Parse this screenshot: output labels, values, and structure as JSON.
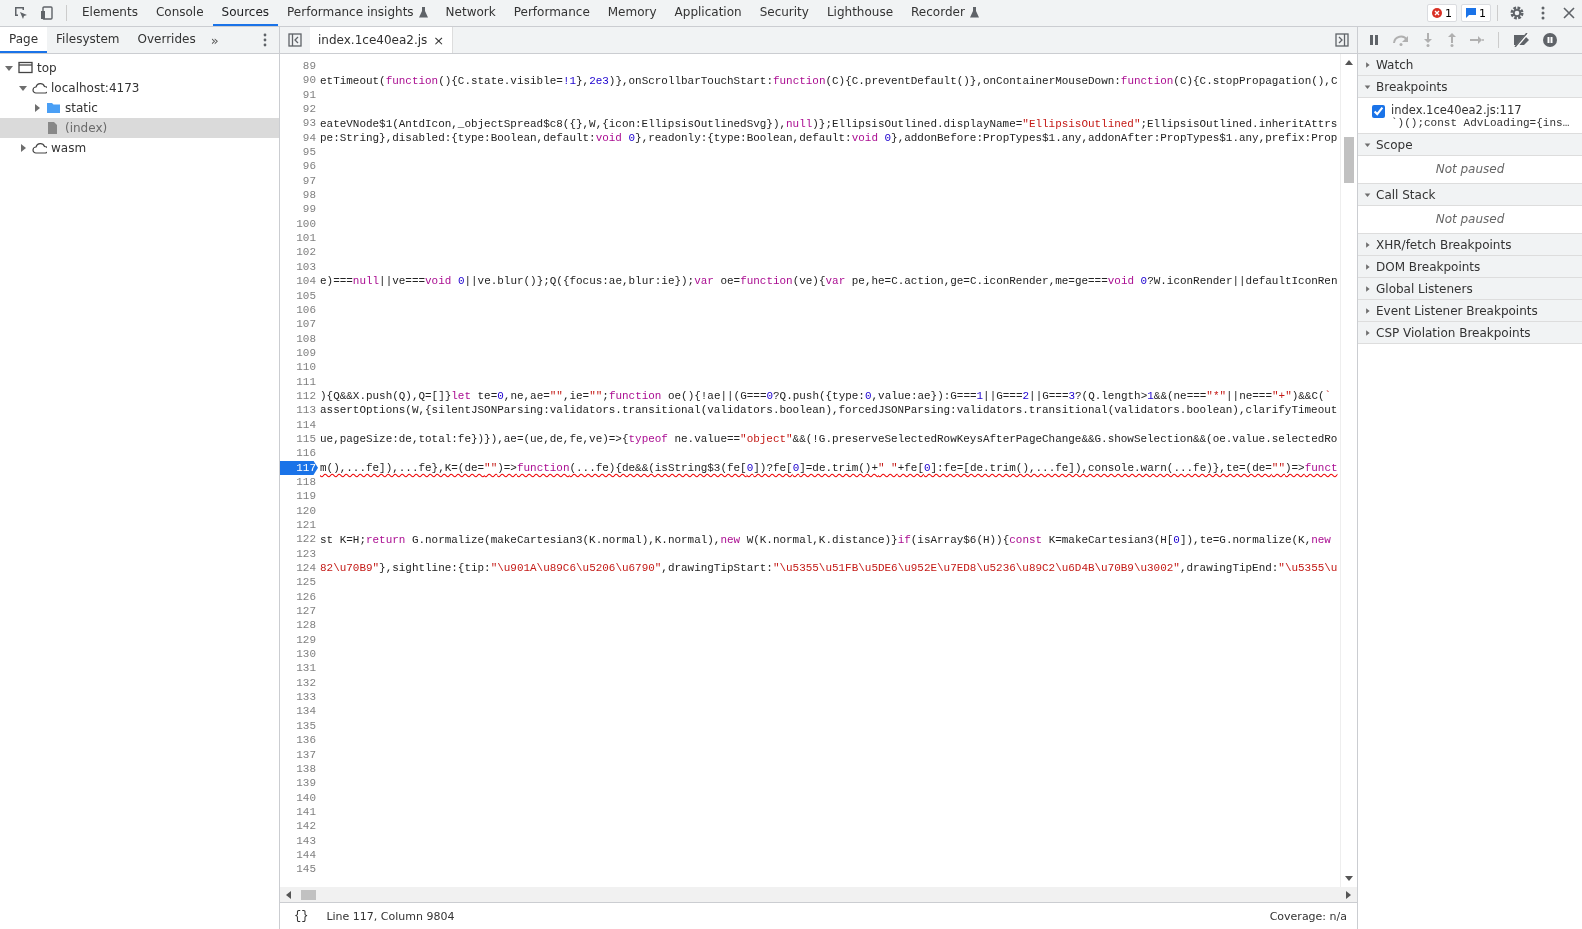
{
  "main_tabs": [
    {
      "label": "Elements",
      "selected": false
    },
    {
      "label": "Console",
      "selected": false
    },
    {
      "label": "Sources",
      "selected": true
    },
    {
      "label": "Performance insights",
      "selected": false,
      "experimental": true
    },
    {
      "label": "Network",
      "selected": false
    },
    {
      "label": "Performance",
      "selected": false
    },
    {
      "label": "Memory",
      "selected": false
    },
    {
      "label": "Application",
      "selected": false
    },
    {
      "label": "Security",
      "selected": false
    },
    {
      "label": "Lighthouse",
      "selected": false
    },
    {
      "label": "Recorder",
      "selected": false,
      "experimental": true
    }
  ],
  "counters": [
    {
      "kind": "error",
      "count": "1"
    },
    {
      "kind": "message",
      "count": "1"
    }
  ],
  "navigator": {
    "tabs": [
      {
        "label": "Page",
        "selected": true
      },
      {
        "label": "Filesystem",
        "selected": false
      },
      {
        "label": "Overrides",
        "selected": false
      }
    ],
    "more": "»",
    "tree": [
      {
        "label": "top",
        "kind": "frame",
        "expanded": true,
        "selected": false,
        "children": [
          {
            "label": "localhost:4173",
            "kind": "cloud",
            "expanded": true,
            "selected": false,
            "children": [
              {
                "label": "static",
                "kind": "folder",
                "expanded": false,
                "selected": false
              },
              {
                "label": "(index)",
                "kind": "file",
                "selected": true
              }
            ]
          },
          {
            "label": "wasm",
            "kind": "cloud",
            "expanded": false,
            "selected": false
          }
        ]
      }
    ]
  },
  "editor": {
    "file_tab": {
      "label": "index.1ce40ea2.js",
      "close": "×"
    },
    "lines": [
      {
        "number": "89"
      },
      {
        "number": "90",
        "tokens": [
          {
            "text": "etTimeout(",
            "kind": "plain"
          },
          {
            "text": "function",
            "kind": "keyword"
          },
          {
            "text": "(){C.state.visible=",
            "kind": "plain"
          },
          {
            "text": "!1",
            "kind": "number"
          },
          {
            "text": "},",
            "kind": "plain"
          },
          {
            "text": "2e3",
            "kind": "number"
          },
          {
            "text": ")},onScrollbarTouchStart:",
            "kind": "plain"
          },
          {
            "text": "function",
            "kind": "keyword"
          },
          {
            "text": "(C){C.preventDefault()},onContainerMouseDown:",
            "kind": "plain"
          },
          {
            "text": "function",
            "kind": "keyword"
          },
          {
            "text": "(C){C.stopPropagation(),C",
            "kind": "plain"
          }
        ]
      },
      {
        "number": "91"
      },
      {
        "number": "92"
      },
      {
        "number": "93",
        "tokens": [
          {
            "text": "eateVNode$1(AntdIcon,_objectSpread$c8({},W,{icon:EllipsisOutlinedSvg}),",
            "kind": "plain"
          },
          {
            "text": "null",
            "kind": "keyword"
          },
          {
            "text": ")};EllipsisOutlined.displayName=",
            "kind": "plain"
          },
          {
            "text": "\"EllipsisOutlined\"",
            "kind": "string"
          },
          {
            "text": ";EllipsisOutlined.inheritAttrs",
            "kind": "plain"
          }
        ]
      },
      {
        "number": "94",
        "tokens": [
          {
            "text": "pe:String},disabled:{type:Boolean,default:",
            "kind": "plain"
          },
          {
            "text": "void ",
            "kind": "keyword"
          },
          {
            "text": "0",
            "kind": "number"
          },
          {
            "text": "},readonly:{type:Boolean,default:",
            "kind": "plain"
          },
          {
            "text": "void ",
            "kind": "keyword"
          },
          {
            "text": "0",
            "kind": "number"
          },
          {
            "text": "},addonBefore:PropTypes$1.any,addonAfter:PropTypes$1.any,prefix:Prop",
            "kind": "plain"
          }
        ]
      },
      {
        "number": "95"
      },
      {
        "number": "96"
      },
      {
        "number": "97"
      },
      {
        "number": "98"
      },
      {
        "number": "99"
      },
      {
        "number": "100"
      },
      {
        "number": "101"
      },
      {
        "number": "102"
      },
      {
        "number": "103"
      },
      {
        "number": "104",
        "tokens": [
          {
            "text": "e)===",
            "kind": "plain"
          },
          {
            "text": "null",
            "kind": "keyword"
          },
          {
            "text": "||ve===",
            "kind": "plain"
          },
          {
            "text": "void ",
            "kind": "keyword"
          },
          {
            "text": "0",
            "kind": "number"
          },
          {
            "text": "||ve.blur()};Q({focus:ae,blur:ie});",
            "kind": "plain"
          },
          {
            "text": "var",
            "kind": "keyword"
          },
          {
            "text": " oe=",
            "kind": "plain"
          },
          {
            "text": "function",
            "kind": "keyword"
          },
          {
            "text": "(ve){",
            "kind": "plain"
          },
          {
            "text": "var",
            "kind": "keyword"
          },
          {
            "text": " pe,he=C.action,ge=C.iconRender,me=ge===",
            "kind": "plain"
          },
          {
            "text": "void ",
            "kind": "keyword"
          },
          {
            "text": "0",
            "kind": "number"
          },
          {
            "text": "?W.iconRender||defaultIconRen",
            "kind": "plain"
          }
        ]
      },
      {
        "number": "105"
      },
      {
        "number": "106"
      },
      {
        "number": "107"
      },
      {
        "number": "108"
      },
      {
        "number": "109"
      },
      {
        "number": "110"
      },
      {
        "number": "111"
      },
      {
        "number": "112",
        "tokens": [
          {
            "text": "){Q&&X.push(Q),Q=[]}",
            "kind": "plain"
          },
          {
            "text": "let",
            "kind": "keyword"
          },
          {
            "text": " te=",
            "kind": "plain"
          },
          {
            "text": "0",
            "kind": "number"
          },
          {
            "text": ",ne,ae=",
            "kind": "plain"
          },
          {
            "text": "\"\"",
            "kind": "string"
          },
          {
            "text": ",ie=",
            "kind": "plain"
          },
          {
            "text": "\"\"",
            "kind": "string"
          },
          {
            "text": ";",
            "kind": "plain"
          },
          {
            "text": "function",
            "kind": "keyword"
          },
          {
            "text": " oe(){!ae||(G===",
            "kind": "plain"
          },
          {
            "text": "0",
            "kind": "number"
          },
          {
            "text": "?Q.push({type:",
            "kind": "plain"
          },
          {
            "text": "0",
            "kind": "number"
          },
          {
            "text": ",value:ae}):G===",
            "kind": "plain"
          },
          {
            "text": "1",
            "kind": "number"
          },
          {
            "text": "||G===",
            "kind": "plain"
          },
          {
            "text": "2",
            "kind": "number"
          },
          {
            "text": "||G===",
            "kind": "plain"
          },
          {
            "text": "3",
            "kind": "number"
          },
          {
            "text": "?(Q.length>",
            "kind": "plain"
          },
          {
            "text": "1",
            "kind": "number"
          },
          {
            "text": "&&(ne===",
            "kind": "plain"
          },
          {
            "text": "\"*\"",
            "kind": "string"
          },
          {
            "text": "||ne===",
            "kind": "plain"
          },
          {
            "text": "\"+\"",
            "kind": "string"
          },
          {
            "text": ")&&C(",
            "kind": "plain"
          },
          {
            "text": "`",
            "kind": "string"
          }
        ]
      },
      {
        "number": "113",
        "tokens": [
          {
            "text": "assertOptions(W,{silentJSONParsing:validators.transitional(validators.boolean),forcedJSONParsing:validators.transitional(validators.boolean),clarifyTimeout",
            "kind": "plain"
          }
        ]
      },
      {
        "number": "114"
      },
      {
        "number": "115",
        "tokens": [
          {
            "text": "ue,pageSize:de,total:fe})}),ae=(ue,de,fe,ve)=>{",
            "kind": "plain"
          },
          {
            "text": "typeof",
            "kind": "keyword"
          },
          {
            "text": " ne.value==",
            "kind": "plain"
          },
          {
            "text": "\"object\"",
            "kind": "string"
          },
          {
            "text": "&&(!G.preserveSelectedRowKeysAfterPageChange&&G.showSelection&&(oe.value.selectedRo",
            "kind": "plain"
          }
        ]
      },
      {
        "number": "116"
      },
      {
        "number": "117",
        "breakpoint": true,
        "error_underline": true,
        "tokens": [
          {
            "text": "m(),...fe]),...fe},K=(de=",
            "kind": "plain"
          },
          {
            "text": "\"\"",
            "kind": "string"
          },
          {
            "text": ")=>",
            "kind": "plain"
          },
          {
            "text": "function",
            "kind": "keyword"
          },
          {
            "text": "(...fe){de&&(isString$3(fe[",
            "kind": "plain"
          },
          {
            "text": "0",
            "kind": "number"
          },
          {
            "text": "])?fe[",
            "kind": "plain"
          },
          {
            "text": "0",
            "kind": "number"
          },
          {
            "text": "]=de.trim()+",
            "kind": "plain"
          },
          {
            "text": "\" \"",
            "kind": "string"
          },
          {
            "text": "+fe[",
            "kind": "plain"
          },
          {
            "text": "0",
            "kind": "number"
          },
          {
            "text": "]:fe=[de.trim(),...fe]),console.warn(...fe)},te=(de=",
            "kind": "plain"
          },
          {
            "text": "\"\"",
            "kind": "string"
          },
          {
            "text": ")=>",
            "kind": "plain"
          },
          {
            "text": "funct",
            "kind": "keyword"
          }
        ]
      },
      {
        "number": "118"
      },
      {
        "number": "119"
      },
      {
        "number": "120"
      },
      {
        "number": "121"
      },
      {
        "number": "122",
        "tokens": [
          {
            "text": "st K=H;",
            "kind": "plain"
          },
          {
            "text": "return",
            "kind": "keyword"
          },
          {
            "text": " G.normalize(makeCartesian3(K.normal),K.normal),",
            "kind": "plain"
          },
          {
            "text": "new",
            "kind": "keyword"
          },
          {
            "text": " W(K.normal,K.distance)}",
            "kind": "plain"
          },
          {
            "text": "if",
            "kind": "keyword"
          },
          {
            "text": "(isArray$6(H)){",
            "kind": "plain"
          },
          {
            "text": "const",
            "kind": "keyword"
          },
          {
            "text": " K=makeCartesian3(H[",
            "kind": "plain"
          },
          {
            "text": "0",
            "kind": "number"
          },
          {
            "text": "]),te=G.normalize(K,",
            "kind": "plain"
          },
          {
            "text": "new",
            "kind": "keyword"
          }
        ]
      },
      {
        "number": "123"
      },
      {
        "number": "124",
        "tokens": [
          {
            "text": "82\\u70B9\"",
            "kind": "string"
          },
          {
            "text": "},sightline:{tip:",
            "kind": "plain"
          },
          {
            "text": "\"\\u901A\\u89C6\\u5206\\u6790\"",
            "kind": "string"
          },
          {
            "text": ",drawingTipStart:",
            "kind": "plain"
          },
          {
            "text": "\"\\u5355\\u51FB\\u5DE6\\u952E\\u7ED8\\u5236\\u89C2\\u6D4B\\u70B9\\u3002\"",
            "kind": "string"
          },
          {
            "text": ",drawingTipEnd:",
            "kind": "plain"
          },
          {
            "text": "\"\\u5355\\u",
            "kind": "string"
          }
        ]
      },
      {
        "number": "125"
      },
      {
        "number": "126"
      },
      {
        "number": "127"
      },
      {
        "number": "128"
      },
      {
        "number": "129"
      },
      {
        "number": "130"
      },
      {
        "number": "131"
      },
      {
        "number": "132"
      },
      {
        "number": "133"
      },
      {
        "number": "134"
      },
      {
        "number": "135"
      },
      {
        "number": "136"
      },
      {
        "number": "137"
      },
      {
        "number": "138"
      },
      {
        "number": "139"
      },
      {
        "number": "140"
      },
      {
        "number": "141"
      },
      {
        "number": "142"
      },
      {
        "number": "143"
      },
      {
        "number": "144"
      },
      {
        "number": "145"
      }
    ]
  },
  "status_bar": {
    "format_button": "{}",
    "position": "Line 117, Column 9804",
    "coverage": "Coverage: n/a"
  },
  "debugger": {
    "sections": [
      {
        "title": "Watch",
        "expanded": false
      },
      {
        "title": "Breakpoints",
        "expanded": true,
        "breakpoints": [
          {
            "checked": true,
            "location": "index.1ce40ea2.js:117",
            "code": "`)();const AdvLoading={ins…"
          }
        ]
      },
      {
        "title": "Scope",
        "expanded": true,
        "message": "Not paused"
      },
      {
        "title": "Call Stack",
        "expanded": true,
        "message": "Not paused"
      },
      {
        "title": "XHR/fetch Breakpoints",
        "expanded": false
      },
      {
        "title": "DOM Breakpoints",
        "expanded": false
      },
      {
        "title": "Global Listeners",
        "expanded": false
      },
      {
        "title": "Event Listener Breakpoints",
        "expanded": false
      },
      {
        "title": "CSP Violation Breakpoints",
        "expanded": false
      }
    ]
  }
}
